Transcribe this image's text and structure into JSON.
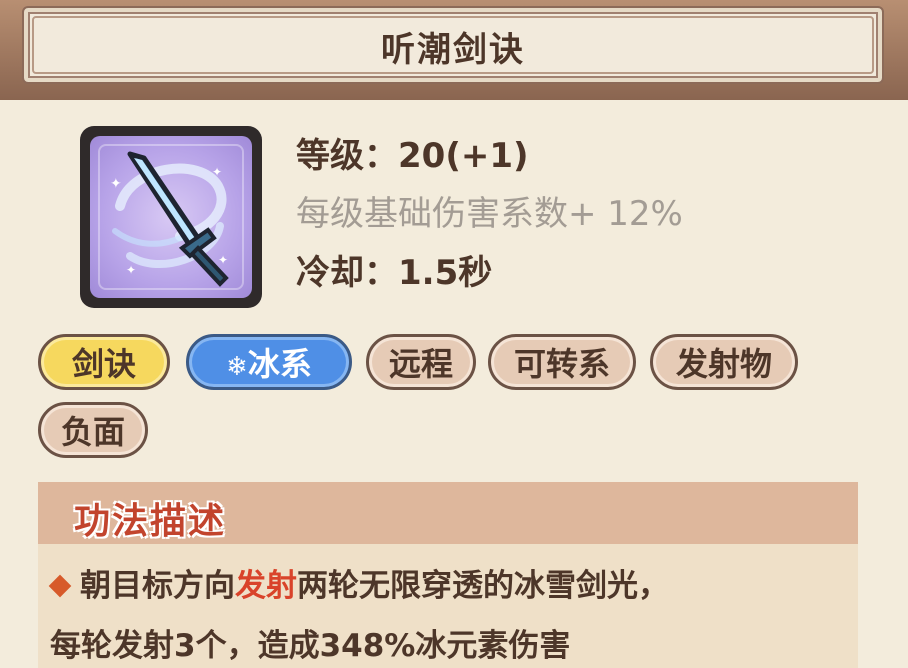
{
  "title": "听潮剑诀",
  "stats": {
    "level": "等级：20(+1)",
    "per_level_bonus": "每级基础伤害系数+ 12%",
    "cooldown": "冷却：1.5秒"
  },
  "tags": [
    {
      "label": "剑诀",
      "style": "yellow"
    },
    {
      "label": "冰系",
      "style": "blue",
      "icon": "snowflake-icon"
    },
    {
      "label": "远程",
      "style": "beige"
    },
    {
      "label": "可转系",
      "style": "beige"
    },
    {
      "label": "发射物",
      "style": "beige"
    },
    {
      "label": "负面",
      "style": "beige"
    }
  ],
  "description": {
    "header": "功法描述",
    "line1_part1": "朝目标方向",
    "line1_highlight": "发射",
    "line1_part2": "两轮无限穿透的冰雪剑光，",
    "line2": "每轮发射3个，造成348%冰元素伤害"
  },
  "colors": {
    "highlight": "#d9432a",
    "text": "#4d3629",
    "ice_tag": "#4f8fe6",
    "sword_tag": "#f6d85e"
  }
}
